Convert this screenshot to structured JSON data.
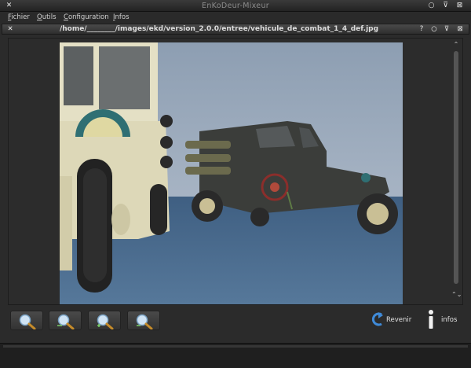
{
  "window": {
    "title": "EnKoDeur-Mixeur",
    "close_glyph": "✕",
    "controls": [
      "○",
      "⊽",
      "⊠"
    ]
  },
  "menubar": {
    "items": [
      {
        "mnemonic": "F",
        "rest": "ichier"
      },
      {
        "mnemonic": "O",
        "rest": "utils"
      },
      {
        "mnemonic": "C",
        "rest": "onfiguration"
      },
      {
        "mnemonic": "I",
        "rest": "nfos"
      }
    ]
  },
  "subwindow": {
    "path": "/home/________/images/ekd/version_2.0.0/entree/vehicule_de_combat_1_4_def.jpg",
    "close_glyph": "✕",
    "controls": [
      "?",
      "○",
      "⊽",
      "⊠"
    ]
  },
  "preview": {
    "icon": "image-preview",
    "scroll_fraction": 0.0
  },
  "scrollbar": {
    "up_glyph": "⌃",
    "updown_glyph": "⌃⌄"
  },
  "zoom_buttons": [
    {
      "icon": "zoom-fit-icon"
    },
    {
      "icon": "zoom-original-icon"
    },
    {
      "icon": "zoom-in-icon"
    },
    {
      "icon": "zoom-out-icon"
    }
  ],
  "actions": {
    "revenir_label": "Revenir",
    "infos_label": "infos"
  },
  "colors": {
    "background": "#2b2b2b",
    "sky": "#93a3b7",
    "floor": "#4a6a8c"
  }
}
